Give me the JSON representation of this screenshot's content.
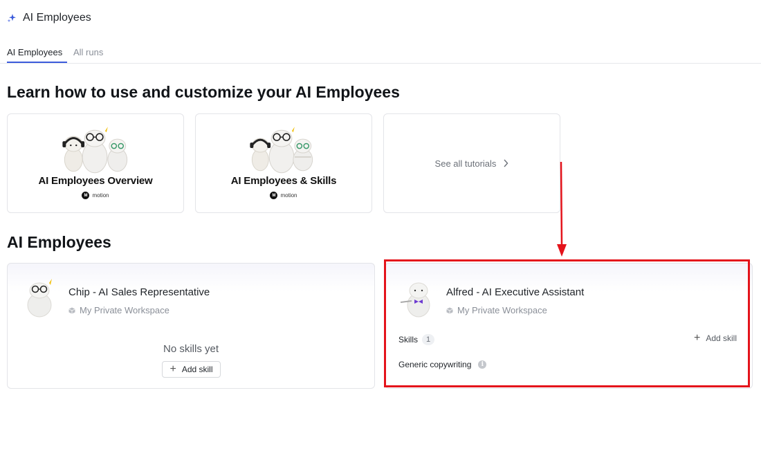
{
  "header": {
    "title": "AI Employees",
    "icon": "sparkle-icon",
    "accent": "#3b5bdb"
  },
  "tabs": [
    {
      "label": "AI Employees",
      "active": true
    },
    {
      "label": "All runs",
      "active": false
    }
  ],
  "tutorials": {
    "heading": "Learn how to use and customize your AI Employees",
    "cards": [
      {
        "title": "AI Employees Overview",
        "brand": "motion",
        "brand_mark": "M"
      },
      {
        "title": "AI Employees & Skills",
        "brand": "motion",
        "brand_mark": "M"
      }
    ],
    "see_all": "See all tutorials"
  },
  "employees": {
    "heading": "AI Employees",
    "items": [
      {
        "name": "Chip - AI Sales Representative",
        "workspace": "My Private Workspace",
        "empty_text": "No skills yet",
        "add_skill_label": "Add skill"
      },
      {
        "name": "Alfred - AI Executive Assistant",
        "workspace": "My Private Workspace",
        "skills_label": "Skills",
        "skills_count": "1",
        "add_skill_label": "Add skill",
        "skills": [
          "Generic copywriting"
        ],
        "info_glyph": "i"
      }
    ]
  },
  "annotation": {
    "color": "#e4131b"
  }
}
